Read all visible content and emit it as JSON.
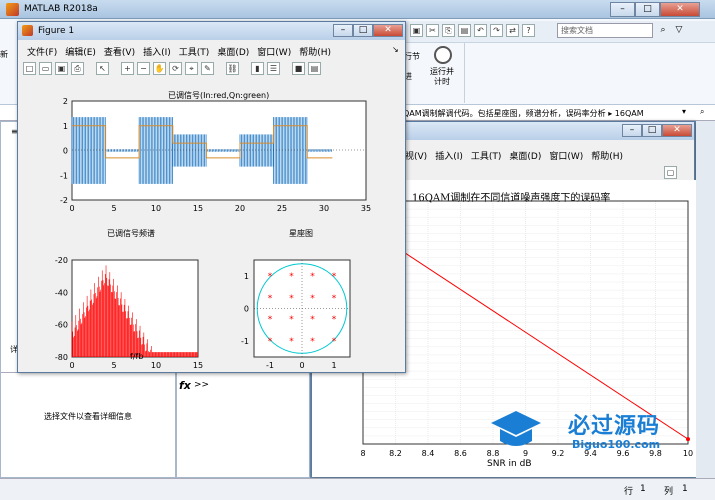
{
  "app": {
    "title": "MATLAB R2018a"
  },
  "search": {
    "placeholder": "搜索文档"
  },
  "ribbon": {
    "run_advance": "运行并\n计时",
    "run_section": "行节",
    "advance": "进"
  },
  "path": {
    "text": "QAM调制解调代码。包括星座图，频谱分析，误码率分析 ▸ 16QAM"
  },
  "left_panel": {
    "detail_label": "详",
    "select_file_hint": "选择文件以查看详细信息"
  },
  "command": {
    "fx": "fx",
    "prompt": ">>"
  },
  "status": {
    "row_label": "行",
    "row_value": "1",
    "col_label": "列",
    "col_value": "1"
  },
  "figure1": {
    "title": "Figure 1",
    "menu": [
      "文件(F)",
      "编辑(E)",
      "查看(V)",
      "插入(I)",
      "工具(T)",
      "桌面(D)",
      "窗口(W)",
      "帮助(H)"
    ],
    "plot_top": {
      "title": "已调信号(In:red,Qn:green)",
      "xticks": [
        "0",
        "5",
        "10",
        "15",
        "20",
        "25",
        "30",
        "35"
      ],
      "yticks": [
        "2",
        "1",
        "0",
        "-1",
        "-2"
      ]
    },
    "plot_spec": {
      "title": "已调信号频谱",
      "xlabel": "f/fb",
      "xticks": [
        "0",
        "5",
        "10",
        "15"
      ],
      "yticks": [
        "-20",
        "-40",
        "-60",
        "-80"
      ]
    },
    "plot_const": {
      "title": "星座图",
      "xticks": [
        "-1",
        "0",
        "1"
      ],
      "yticks": [
        "1",
        "0",
        "-1"
      ]
    }
  },
  "figure2": {
    "menu": [
      "视(V)",
      "插入(I)",
      "工具(T)",
      "桌面(D)",
      "窗口(W)",
      "帮助(H)"
    ],
    "plot": {
      "title": "16QAM调制在不同信道噪声强度下的误码率",
      "xlabel": "SNR in dB",
      "xticks": [
        "8",
        "8.2",
        "8.4",
        "8.6",
        "8.8",
        "9",
        "9.2",
        "9.4",
        "9.6",
        "9.8",
        "10"
      ]
    }
  },
  "watermark": {
    "brand": "必过源码",
    "url": "Biguo100.com"
  },
  "colors": {
    "blue_signal": "#1f77c4",
    "orange_signal": "#d98c2b",
    "red": "#ff0000",
    "cyan": "#00c8d0"
  },
  "chart_data": [
    {
      "type": "line",
      "title": "已调信号(In:red,Qn:green)",
      "xlim": [
        0,
        35
      ],
      "ylim": [
        -2,
        2
      ],
      "series": [
        {
          "values_x": [
            0,
            4,
            4,
            8,
            8,
            12,
            12,
            16,
            16,
            20,
            20,
            24,
            24,
            28,
            28,
            31
          ],
          "values_y": [
            1,
            1,
            -0.3,
            -0.3,
            1,
            1,
            0.3,
            0.3,
            -0.3,
            -0.3,
            0.3,
            0.3,
            1,
            1,
            -0.3,
            -0.3
          ]
        }
      ]
    },
    {
      "type": "line",
      "title": "已调信号频谱",
      "xlabel": "f/fb",
      "xlim": [
        0,
        15
      ],
      "ylim": [
        -80,
        -20
      ]
    },
    {
      "type": "scatter",
      "title": "星座图",
      "xlim": [
        -1.5,
        1.5
      ],
      "ylim": [
        -1.5,
        1.5
      ],
      "points": [
        [
          -1,
          -1
        ],
        [
          -1,
          -0.33
        ],
        [
          -1,
          0.33
        ],
        [
          -1,
          1
        ],
        [
          -0.33,
          -1
        ],
        [
          -0.33,
          -0.33
        ],
        [
          -0.33,
          0.33
        ],
        [
          -0.33,
          1
        ],
        [
          0.33,
          -1
        ],
        [
          0.33,
          -0.33
        ],
        [
          0.33,
          0.33
        ],
        [
          0.33,
          1
        ],
        [
          1,
          -1
        ],
        [
          1,
          -0.33
        ],
        [
          1,
          0.33
        ],
        [
          1,
          1
        ]
      ]
    },
    {
      "type": "line",
      "title": "16QAM调制在不同信道噪声强度下的误码率",
      "xlabel": "SNR in dB",
      "xlim": [
        8,
        10
      ],
      "series": [
        {
          "x": [
            8,
            10
          ],
          "y": [
            0.9,
            0.02
          ]
        }
      ]
    }
  ]
}
